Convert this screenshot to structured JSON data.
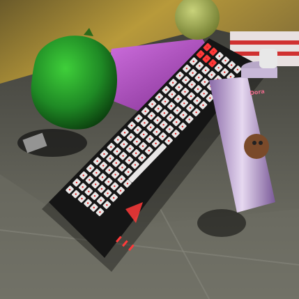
{
  "scene": {
    "description_objects": [
      "mechanical-keyboard",
      "green-bell-pepper",
      "apple",
      "purple-towel",
      "spray-can"
    ],
    "colors": {
      "keyboard_body": "#151515",
      "keycap": "#e8e6e6",
      "keycap_accent": "#ff3a3a",
      "key_legend": "#e02020",
      "pepper": "#1f8a25",
      "towel": "#b14fc4",
      "apple": "#9aa44a",
      "can": "#d8c8e8",
      "floor": "#5a5a52",
      "wall": "#b89a3a"
    }
  },
  "can_label": {
    "brand": "Dora"
  }
}
